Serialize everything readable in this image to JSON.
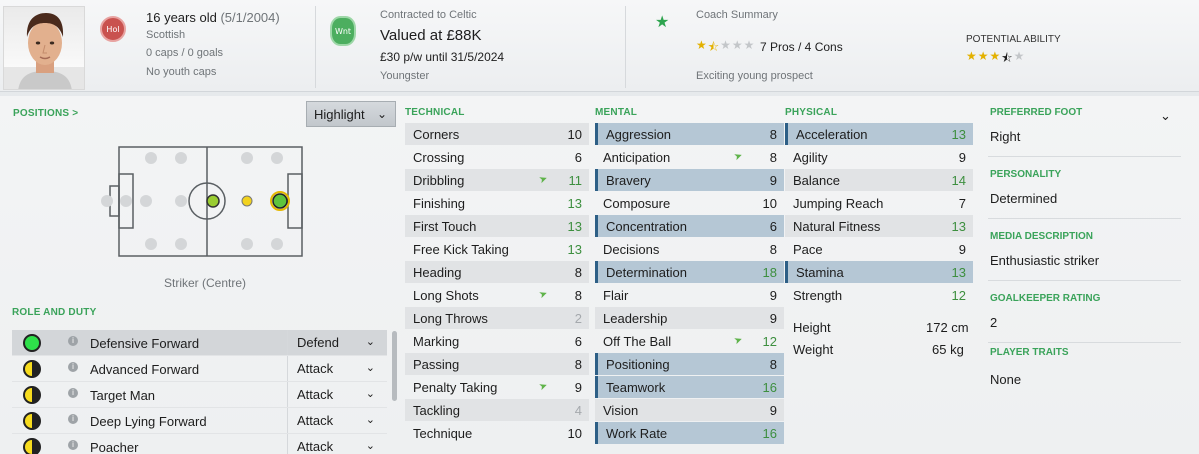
{
  "header": {
    "nation_badge": "Hol",
    "age_line": "16 years old",
    "dob": "(5/1/2004)",
    "nationality": "Scottish",
    "caps": "0 caps / 0 goals",
    "youth_caps": "No youth caps",
    "status_badge": "Wnt",
    "contract": "Contracted to Celtic",
    "value": "Valued at £88K",
    "wage": "£30 p/w until 31/5/2024",
    "squad_status": "Youngster",
    "coach_summary_label": "Coach Summary",
    "pros_cons": "7 Pros / 4 Cons",
    "coach_comment": "Exciting young prospect",
    "potential_label": "POTENTIAL ABILITY",
    "coach_stars": 1.5,
    "potential_stars": 3.5
  },
  "positions": {
    "title": "POSITIONS >",
    "highlight_button": "Highlight",
    "position_caption": "Striker (Centre)"
  },
  "roles": {
    "title": "ROLE AND DUTY",
    "items": [
      {
        "name": "Defensive Forward",
        "duty": "Defend"
      },
      {
        "name": "Advanced Forward",
        "duty": "Attack"
      },
      {
        "name": "Target Man",
        "duty": "Attack"
      },
      {
        "name": "Deep Lying Forward",
        "duty": "Attack"
      },
      {
        "name": "Poacher",
        "duty": "Attack"
      }
    ]
  },
  "technical": {
    "title": "TECHNICAL",
    "attributes": [
      {
        "name": "Corners",
        "value": "10"
      },
      {
        "name": "Crossing",
        "value": "6"
      },
      {
        "name": "Dribbling",
        "value": "11"
      },
      {
        "name": "Finishing",
        "value": "13"
      },
      {
        "name": "First Touch",
        "value": "13"
      },
      {
        "name": "Free Kick Taking",
        "value": "13"
      },
      {
        "name": "Heading",
        "value": "8"
      },
      {
        "name": "Long Shots",
        "value": "8"
      },
      {
        "name": "Long Throws",
        "value": "2"
      },
      {
        "name": "Marking",
        "value": "6"
      },
      {
        "name": "Passing",
        "value": "8"
      },
      {
        "name": "Penalty Taking",
        "value": "9"
      },
      {
        "name": "Tackling",
        "value": "4"
      },
      {
        "name": "Technique",
        "value": "10"
      }
    ]
  },
  "mental": {
    "title": "MENTAL",
    "attributes": [
      {
        "name": "Aggression",
        "value": "8"
      },
      {
        "name": "Anticipation",
        "value": "8"
      },
      {
        "name": "Bravery",
        "value": "9"
      },
      {
        "name": "Composure",
        "value": "10"
      },
      {
        "name": "Concentration",
        "value": "6"
      },
      {
        "name": "Decisions",
        "value": "8"
      },
      {
        "name": "Determination",
        "value": "18"
      },
      {
        "name": "Flair",
        "value": "9"
      },
      {
        "name": "Leadership",
        "value": "9"
      },
      {
        "name": "Off The Ball",
        "value": "12"
      },
      {
        "name": "Positioning",
        "value": "8"
      },
      {
        "name": "Teamwork",
        "value": "16"
      },
      {
        "name": "Vision",
        "value": "9"
      },
      {
        "name": "Work Rate",
        "value": "16"
      }
    ]
  },
  "physical": {
    "title": "PHYSICAL",
    "attributes": [
      {
        "name": "Acceleration",
        "value": "13"
      },
      {
        "name": "Agility",
        "value": "9"
      },
      {
        "name": "Balance",
        "value": "14"
      },
      {
        "name": "Jumping Reach",
        "value": "7"
      },
      {
        "name": "Natural Fitness",
        "value": "13"
      },
      {
        "name": "Pace",
        "value": "9"
      },
      {
        "name": "Stamina",
        "value": "13"
      },
      {
        "name": "Strength",
        "value": "12"
      }
    ],
    "height_label": "Height",
    "height_value": "172 cm",
    "weight_label": "Weight",
    "weight_value": "65 kg"
  },
  "info": {
    "preferred_foot_label": "PREFERRED FOOT",
    "preferred_foot": "Right",
    "personality_label": "PERSONALITY",
    "personality": "Determined",
    "media_label": "MEDIA DESCRIPTION",
    "media": "Enthusiastic striker",
    "gk_label": "GOALKEEPER RATING",
    "gk_rating": "2",
    "traits_label": "PLAYER TRAITS",
    "traits": "None"
  },
  "colors": {
    "accent_green": "#3aa35a",
    "highlight_row": "#b5c7d5",
    "good_value": "#3d8f3f"
  }
}
